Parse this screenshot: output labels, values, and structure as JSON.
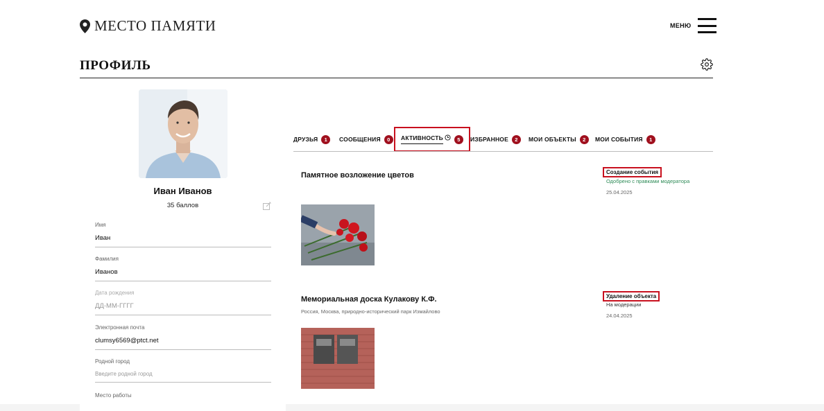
{
  "header": {
    "logo_text": "МЕСТО ПАМЯТИ",
    "menu_label": "МЕНЮ"
  },
  "page": {
    "title": "ПРОФИЛЬ"
  },
  "profile": {
    "name": "Иван Иванов",
    "points": "35 баллов",
    "fields": [
      {
        "label": "Имя",
        "value": "Иван",
        "placeholder": false
      },
      {
        "label": "Фамилия",
        "value": "Иванов",
        "placeholder": false
      },
      {
        "label": "Дата рождения",
        "value": "ДД-ММ-ГГГГ",
        "placeholder": true
      },
      {
        "label": "Электронная почта",
        "value": "clumsy6569@ptct.net",
        "placeholder": false
      },
      {
        "label": "Родной город",
        "value": "Введите родной город",
        "placeholder": true
      },
      {
        "label": "Место работы",
        "value": "",
        "placeholder": true
      }
    ]
  },
  "tabs": [
    {
      "label": "ДРУЗЬЯ",
      "count": "1"
    },
    {
      "label": "СООБЩЕНИЯ",
      "count": "0"
    },
    {
      "label": "АКТИВНОСТЬ",
      "count": "5"
    },
    {
      "label": "ИЗБРАННОЕ",
      "count": "2"
    },
    {
      "label": "МОИ ОБЪЕКТЫ",
      "count": "2"
    },
    {
      "label": "МОИ СОБЫТИЯ",
      "count": "1"
    }
  ],
  "activity": [
    {
      "title": "Памятное возложение цветов",
      "subtitle": "",
      "type": "Создание события",
      "status": "Одобрено с правками модератора",
      "status_color": "#2e8b57",
      "date": "25.04.2025"
    },
    {
      "title": "Мемориальная доска Кулакову К.Ф.",
      "subtitle": "Россия, Москва, природно-исторический парк Измайлово",
      "type": "Удаление объекта",
      "status": "На модерации",
      "status_color": "#333333",
      "date": "24.04.2025"
    }
  ],
  "colors": {
    "accent": "#a0101e",
    "highlight": "#c8101e"
  }
}
